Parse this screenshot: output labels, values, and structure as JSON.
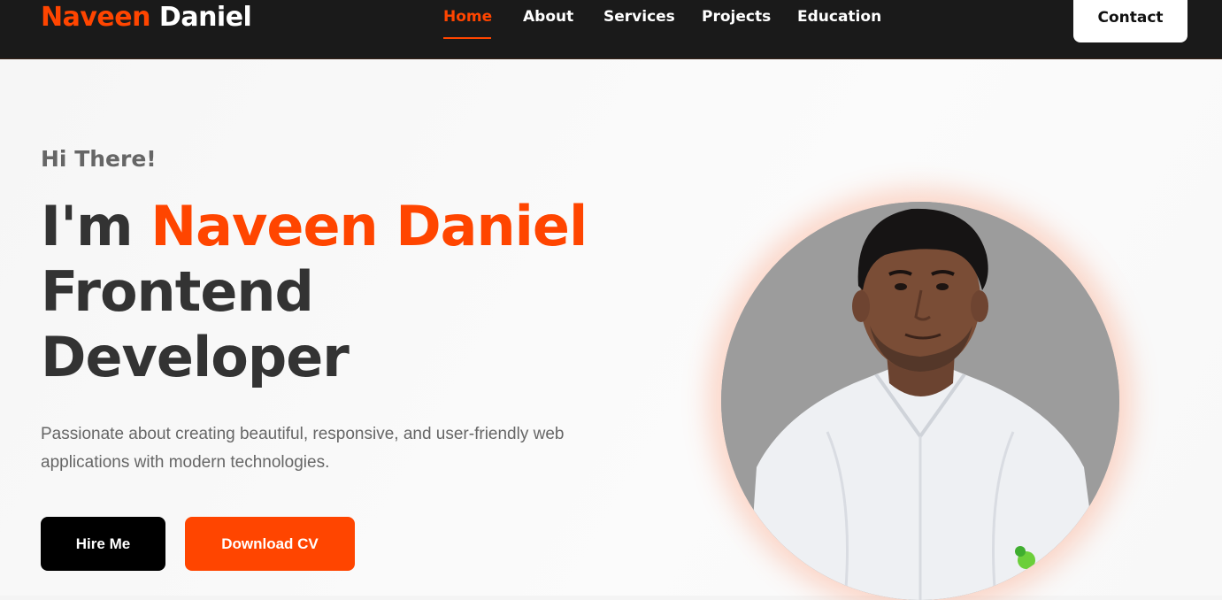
{
  "header": {
    "logo_first": "Naveen",
    "logo_last": "Daniel",
    "nav": [
      {
        "label": "Home",
        "active": true
      },
      {
        "label": "About",
        "active": false
      },
      {
        "label": "Services",
        "active": false
      },
      {
        "label": "Projects",
        "active": false
      },
      {
        "label": "Education",
        "active": false
      }
    ],
    "contact_label": "Contact"
  },
  "hero": {
    "greeting": "Hi There!",
    "intro": "I'm",
    "name": "Naveen Daniel",
    "role_line1": "Frontend",
    "role_line2": "Developer",
    "description": "Passionate about creating beautiful, responsive, and user-friendly web applications with modern technologies.",
    "hire_label": "Hire Me",
    "cv_label": "Download CV"
  },
  "colors": {
    "accent": "#ff4500",
    "nav_bg": "#1a1a1a",
    "heading": "#333333",
    "muted": "#666666"
  }
}
